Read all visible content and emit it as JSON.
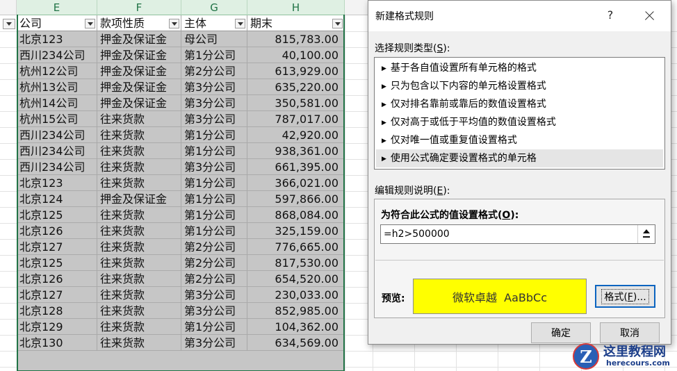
{
  "sheet": {
    "column_letters": [
      "E",
      "F",
      "G",
      "H"
    ],
    "headers": [
      "公司",
      "款项性质",
      "主体",
      "期末"
    ],
    "rows": [
      [
        "北京123",
        "押金及保证金",
        "母公司",
        "815,783.00"
      ],
      [
        "西川234公司",
        "押金及保证金",
        "第1分公司",
        "40,100.00"
      ],
      [
        "杭州12公司",
        "押金及保证金",
        "第2分公司",
        "613,929.00"
      ],
      [
        "杭州13公司",
        "押金及保证金",
        "第3分公司",
        "635,220.00"
      ],
      [
        "杭州14公司",
        "押金及保证金",
        "第3分公司",
        "350,581.00"
      ],
      [
        "杭州15公司",
        "往来货款",
        "第3分公司",
        "787,017.00"
      ],
      [
        "西川234公司",
        "往来货款",
        "第1分公司",
        "42,920.00"
      ],
      [
        "西川234公司",
        "往来货款",
        "第1分公司",
        "938,361.00"
      ],
      [
        "西川234公司",
        "往来货款",
        "第3分公司",
        "661,395.00"
      ],
      [
        "北京123",
        "往来货款",
        "第1分公司",
        "366,021.00"
      ],
      [
        "北京124",
        "押金及保证金",
        "第1分公司",
        "597,866.00"
      ],
      [
        "北京125",
        "往来货款",
        "第1分公司",
        "868,084.00"
      ],
      [
        "北京126",
        "往来货款",
        "第1分公司",
        "325,159.00"
      ],
      [
        "北京127",
        "往来货款",
        "第2分公司",
        "776,665.00"
      ],
      [
        "北京125",
        "往来货款",
        "第2分公司",
        "817,530.00"
      ],
      [
        "北京126",
        "往来货款",
        "第2分公司",
        "654,520.00"
      ],
      [
        "北京127",
        "往来货款",
        "第3分公司",
        "230,033.00"
      ],
      [
        "北京128",
        "往来货款",
        "第3分公司",
        "852,985.00"
      ],
      [
        "北京129",
        "往来货款",
        "第1分公司",
        "104,362.00"
      ],
      [
        "北京130",
        "往来货款",
        "第3分公司",
        "634,569.00"
      ]
    ]
  },
  "dialog": {
    "title": "新建格式规则",
    "help": "?",
    "select_type_label": "选择规则类型(",
    "select_type_key": "S",
    "select_type_end": "):",
    "rule_types": [
      "基于各自值设置所有单元格的格式",
      "只为包含以下内容的单元格设置格式",
      "仅对排名靠前或靠后的数值设置格式",
      "仅对高于或低于平均值的数值设置格式",
      "仅对唯一值或重复值设置格式",
      "使用公式确定要设置格式的单元格"
    ],
    "edit_desc_label": "编辑规则说明(",
    "edit_desc_key": "E",
    "edit_desc_end": "):",
    "formula_label": "为符合此公式的值设置格式(",
    "formula_key": "O",
    "formula_end": "):",
    "formula_value": "=h2>500000",
    "preview_label": "预览:",
    "preview_text": "微软卓越  AaBbCc",
    "format_button": "格式(",
    "format_key": "F",
    "format_end": ")...",
    "ok_button": "确定",
    "cancel_button": "取消"
  },
  "watermark": {
    "logo_letter": "Z",
    "name": "这里教程网",
    "url": "herecours.com"
  },
  "colors": {
    "selection_fill": "#c6c6c6",
    "selection_border": "#217346",
    "preview_fill": "#ffff00",
    "focus_border": "#0b64c0"
  }
}
